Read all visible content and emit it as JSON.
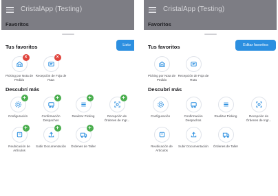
{
  "colors": {
    "accent": "#2c8fe0",
    "remove_badge": "#e0453d",
    "add_badge": "#4caf50",
    "icon": "#2c8fe0"
  },
  "screens": [
    {
      "app_title": "CristalApp (Testing)",
      "subheader": "Favoritos",
      "favorites_title": "Tus favoritos",
      "action_button": "Listo",
      "favorites": [
        {
          "label": "Picking por Nota de Pedido",
          "icon": "picking-icon",
          "badge": "×"
        },
        {
          "label": "Recepción de Foja de Ruta",
          "icon": "receipt-icon",
          "badge": "×"
        }
      ],
      "discover_title": "Descubrí más",
      "discover": [
        {
          "label": "Configuración",
          "icon": "gear-icon",
          "badge": "+"
        },
        {
          "label": "Confirmación Despachos",
          "icon": "truck-icon",
          "badge": "+"
        },
        {
          "label": "Realizar Picking",
          "icon": "list-icon",
          "badge": "+"
        },
        {
          "label": "Recepción de Órdenes de Ingr...",
          "icon": "scan-icon",
          "badge": "+"
        },
        {
          "label": "Reubicación de Artículos",
          "icon": "box-icon",
          "badge": "+"
        },
        {
          "label": "Subir Documentación",
          "icon": "upload-icon",
          "badge": "+"
        },
        {
          "label": "Órdenes de Taller",
          "icon": "delivery-truck-icon",
          "badge": "+"
        }
      ]
    },
    {
      "app_title": "CristalApp (Testing)",
      "subheader": "Favoritos",
      "favorites_title": "Tus favoritos",
      "action_button": "Editar favoritos",
      "favorites": [
        {
          "label": "Picking por Nota de Pedido",
          "icon": "picking-icon"
        },
        {
          "label": "Recepción de Foja de Ruta",
          "icon": "receipt-icon"
        }
      ],
      "discover_title": "Descubrí más",
      "discover": [
        {
          "label": "Configuración",
          "icon": "gear-icon"
        },
        {
          "label": "Confirmación Despachos",
          "icon": "truck-icon"
        },
        {
          "label": "Realizar Picking",
          "icon": "list-icon"
        },
        {
          "label": "Recepción de Órdenes de Ingr...",
          "icon": "scan-icon"
        },
        {
          "label": "Reubicación de Artículos",
          "icon": "box-icon"
        },
        {
          "label": "Subir Documentación",
          "icon": "upload-icon"
        },
        {
          "label": "Órdenes de Taller",
          "icon": "delivery-truck-icon"
        }
      ]
    }
  ]
}
